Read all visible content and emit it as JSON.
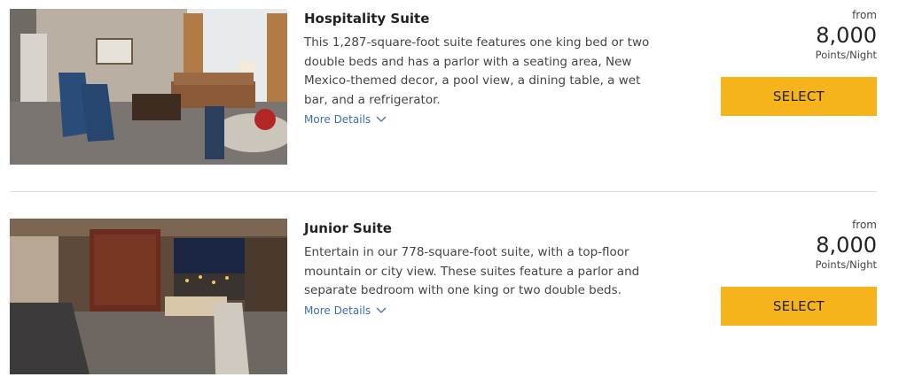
{
  "rooms": [
    {
      "title": "Hospitality Suite",
      "description": "This 1,287-square-foot suite features one king bed or two double beds and has a parlor with a seating area, New Mexico-themed decor, a pool view, a dining table, a wet bar, and a refrigerator.",
      "more_details": "More Details",
      "from_label": "from",
      "points": "8,000",
      "points_unit": "Points/Night",
      "select_label": "SELECT"
    },
    {
      "title": "Junior Suite",
      "description": "Entertain in our 778-square-foot suite, with a top-floor mountain or city view. These suites feature a parlor and separate bedroom with one king or two double beds.",
      "more_details": "More Details",
      "from_label": "from",
      "points": "8,000",
      "points_unit": "Points/Night",
      "select_label": "SELECT"
    }
  ],
  "colors": {
    "accent": "#f7b31b",
    "link": "#3f6fa6",
    "divider": "#dcdcdc"
  }
}
